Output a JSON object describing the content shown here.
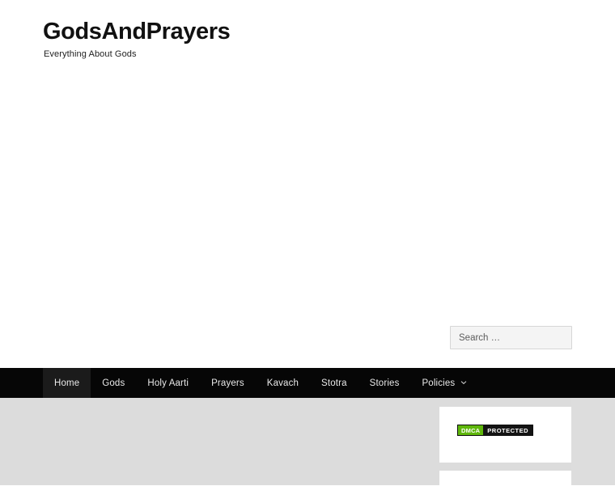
{
  "header": {
    "site_title": "GodsAndPrayers",
    "tagline": "Everything About Gods"
  },
  "search": {
    "placeholder": "Search …",
    "value": ""
  },
  "nav": {
    "items": [
      {
        "label": "Home",
        "current": true,
        "has_dropdown": false
      },
      {
        "label": "Gods",
        "current": false,
        "has_dropdown": false
      },
      {
        "label": "Holy Aarti",
        "current": false,
        "has_dropdown": false
      },
      {
        "label": "Prayers",
        "current": false,
        "has_dropdown": false
      },
      {
        "label": "Kavach",
        "current": false,
        "has_dropdown": false
      },
      {
        "label": "Stotra",
        "current": false,
        "has_dropdown": false
      },
      {
        "label": "Stories",
        "current": false,
        "has_dropdown": false
      },
      {
        "label": "Policies",
        "current": false,
        "has_dropdown": true
      }
    ]
  },
  "sidebar": {
    "widgets": [
      {
        "type": "dmca-badge",
        "badge_left": "DMCA",
        "badge_right": "PROTECTED"
      },
      {
        "type": "blank-widget"
      }
    ]
  },
  "colors": {
    "nav_background": "#060606",
    "nav_current_background": "#1b1b1b",
    "nav_text": "#e9e9e9",
    "page_background": "#ffffff",
    "content_background": "#dcdcdc",
    "widget_background": "#ffffff",
    "search_background": "#f4f4f4",
    "search_border": "#d6d6d6",
    "dmca_green": "#5fb70c",
    "dmca_black": "#141414",
    "title_text": "#111111"
  }
}
